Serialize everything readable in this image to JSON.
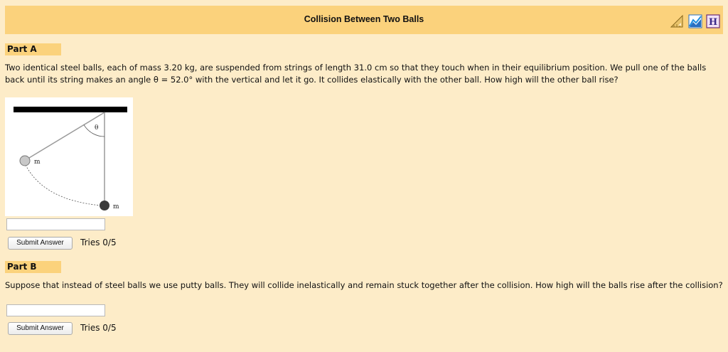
{
  "header": {
    "title": "Collision Between Two Balls",
    "icons": [
      "ruler-triangle-icon",
      "graph-icon",
      "hint-icon"
    ]
  },
  "part_a": {
    "label": "Part A",
    "question": "Two identical steel balls, each of mass 3.20 kg, are suspended from strings of length 31.0 cm so that they touch when in their equilibrium position. We pull one of the balls back until its string makes an angle θ = 52.0° with the vertical and let it go. It collides elastically with the other ball. How high will the other ball rise?",
    "figure": {
      "angle_label": "θ",
      "mass_label_left": "m",
      "mass_label_right": "m"
    },
    "answer_value": "",
    "submit_label": "Submit Answer",
    "tries": "Tries 0/5"
  },
  "part_b": {
    "label": "Part B",
    "question": "Suppose that instead of steel balls we use putty balls. They will collide inelastically and remain stuck together after the collision. How high will the balls rise after the collision?",
    "answer_value": "",
    "submit_label": "Submit Answer",
    "tries": "Tries 0/5"
  },
  "colors": {
    "background": "#fdecc8",
    "accent": "#fbd27c"
  }
}
